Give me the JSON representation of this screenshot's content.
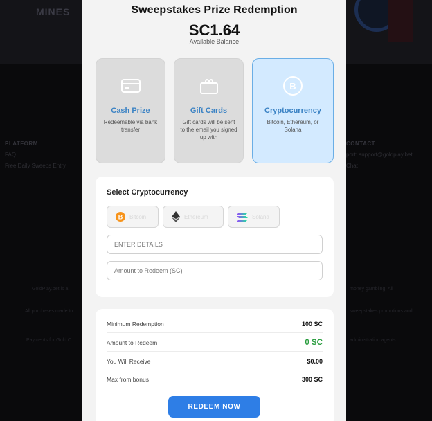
{
  "modal": {
    "title": "Sweepstakes Prize Redemption",
    "balance": "SC1.64",
    "balance_label": "Available Balance"
  },
  "options": [
    {
      "label": "Cash Prize",
      "description": "Redeemable via bank transfer",
      "icon": "credit-card-icon"
    },
    {
      "label": "Gift Cards",
      "description": "Gift cards will be sent to the email you signed up with",
      "icon": "gift-card-icon"
    },
    {
      "label": "Cryptocurrency",
      "description": "Bitcoin, Ethereum, or Solana",
      "icon": "bitcoin-icon",
      "selected": true
    }
  ],
  "crypto_select": {
    "title": "Select Cryptocurrency",
    "coins": [
      {
        "name": "Bitcoin",
        "icon": "bitcoin-icon",
        "color": "#f7931a"
      },
      {
        "name": "Ethereum",
        "icon": "ethereum-icon",
        "color": "#333333"
      },
      {
        "name": "Solana",
        "icon": "solana-icon",
        "color": "#9945ff"
      }
    ],
    "details_placeholder": "ENTER DETAILS",
    "amount_placeholder": "Amount to Redeem (SC)"
  },
  "summary": [
    {
      "label": "Minimum Redemption",
      "value": "100 SC"
    },
    {
      "label": "Amount to Redeem",
      "value": "0 SC"
    },
    {
      "label": "You Will Receive",
      "value": "$0.00"
    },
    {
      "label": "Max from bonus",
      "value": "300 SC"
    }
  ],
  "redeem_button": "REDEEM NOW",
  "colors": {
    "accent": "#2e7ee6",
    "selected_card_bg": "#d3eaff",
    "amount_green": "#2a9d3f"
  }
}
